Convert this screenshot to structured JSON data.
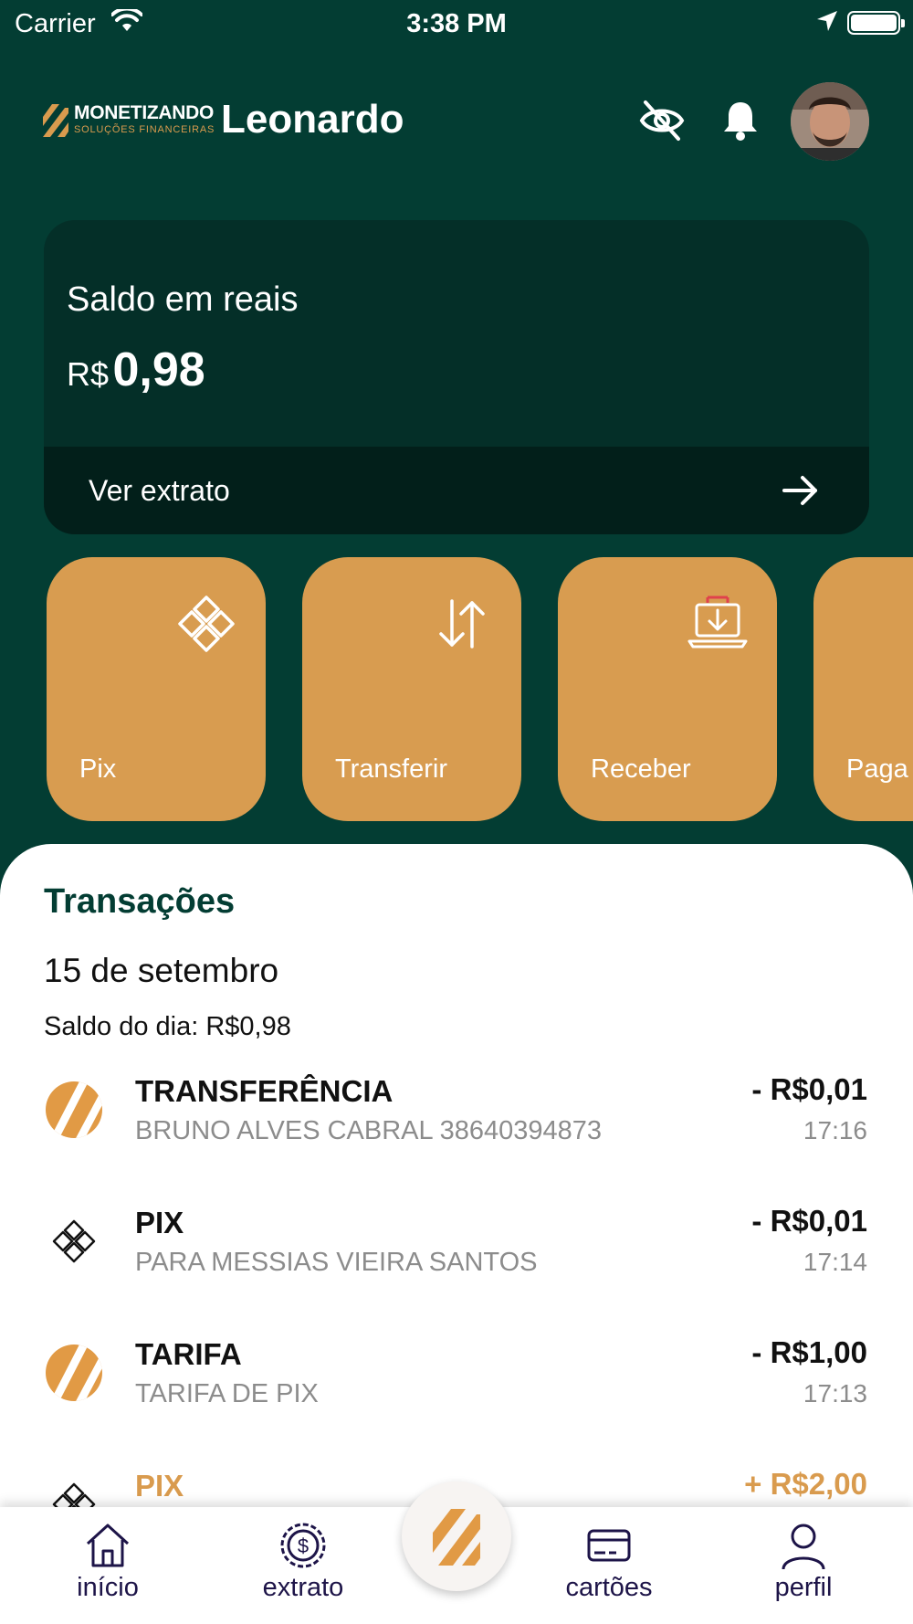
{
  "status_bar": {
    "carrier": "Carrier",
    "time": "3:38 PM"
  },
  "header": {
    "brand": "MONETIZANDO",
    "brand_tagline": "SOLUÇÕES FINANCEIRAS",
    "user_name": "Leonardo"
  },
  "balance": {
    "title": "Saldo em reais",
    "currency": "R$",
    "amount": "0,98",
    "statement_link": "Ver extrato"
  },
  "actions": [
    {
      "label": "Pix",
      "icon": "pix-icon"
    },
    {
      "label": "Transferir",
      "icon": "transfer-arrows-icon"
    },
    {
      "label": "Receber",
      "icon": "receive-download-icon"
    },
    {
      "label": "Paga",
      "icon": "pay-icon"
    }
  ],
  "transactions": {
    "title": "Transações",
    "date": "15 de setembro",
    "day_balance": "Saldo do dia: R$0,98",
    "items": [
      {
        "title": "TRANSFERÊNCIA",
        "subtitle": "BRUNO ALVES CABRAL 38640394873",
        "amount": "- R$0,01",
        "time": "17:16",
        "icon": "monetizando-logo-icon"
      },
      {
        "title": "PIX",
        "subtitle": "PARA MESSIAS VIEIRA SANTOS",
        "amount": "- R$0,01",
        "time": "17:14",
        "icon": "pix-icon"
      },
      {
        "title": "TARIFA",
        "subtitle": "TARIFA DE PIX",
        "amount": "- R$1,00",
        "time": "17:13",
        "icon": "monetizando-logo-icon"
      },
      {
        "title": "PIX",
        "subtitle": "",
        "amount": "+ R$2,00",
        "time": "",
        "icon": "pix-icon"
      }
    ]
  },
  "bottom_nav": {
    "items": [
      {
        "label": "início",
        "icon": "home-icon"
      },
      {
        "label": "extrato",
        "icon": "dollar-coin-icon"
      },
      {
        "label": "cartões",
        "icon": "card-icon"
      },
      {
        "label": "perfil",
        "icon": "user-icon"
      }
    ]
  },
  "colors": {
    "primary_green": "#033d33",
    "card_dark": "#042f28",
    "accent_gold": "#d89c50",
    "nav_text": "#1d1448"
  }
}
